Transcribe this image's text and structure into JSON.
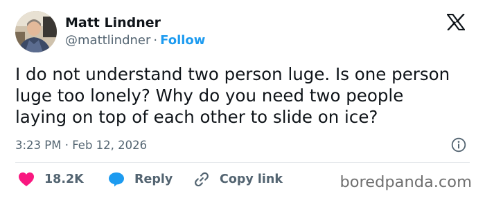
{
  "author": {
    "display_name": "Matt Lindner",
    "handle": "@mattlindner",
    "separator": "·",
    "follow_label": "Follow"
  },
  "tweet": {
    "text": "I do not understand two person luge. Is one person\nluge too lonely? Why do you need two people\nlaying on top of each other to slide on ice?",
    "timestamp": "3:23 PM · Feb 12, 2026"
  },
  "actions": {
    "like_count": "18.2K",
    "reply_label": "Reply",
    "copy_label": "Copy link"
  },
  "watermark": "boredpanda.com",
  "colors": {
    "accent": "#1d9bf0",
    "like": "#f91880",
    "text_primary": "#0f1419",
    "text_secondary": "#536471"
  },
  "icons": {
    "platform": "x-logo-icon",
    "info": "info-icon",
    "like": "heart-icon",
    "reply": "speech-bubble-icon",
    "copy": "link-icon"
  }
}
